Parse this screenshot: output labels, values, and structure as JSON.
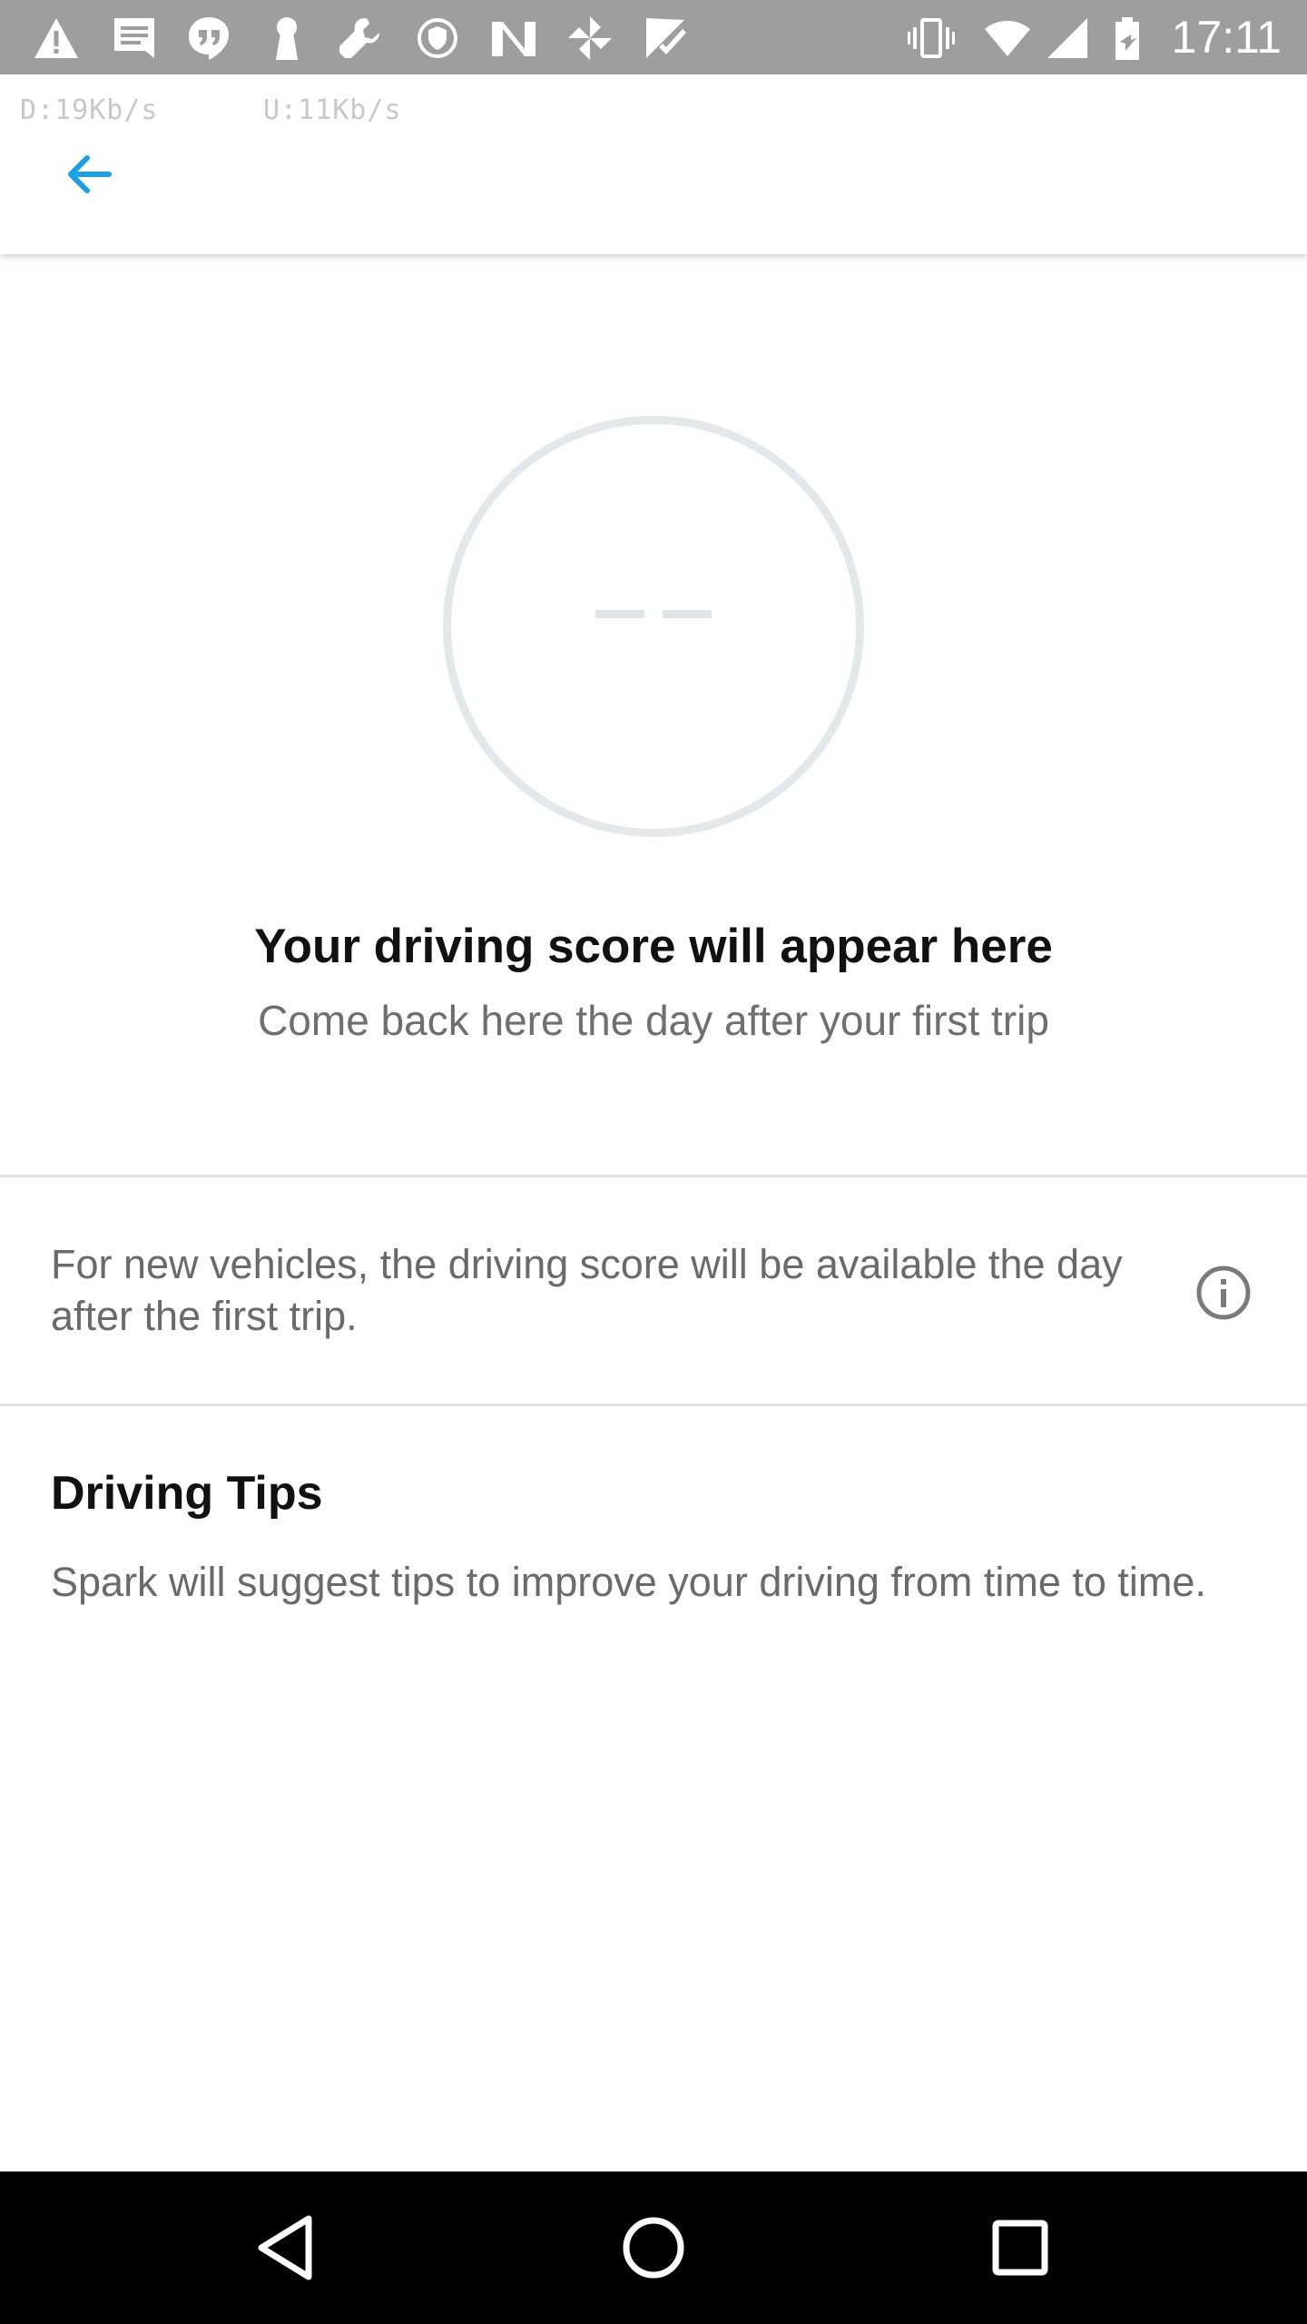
{
  "status_bar": {
    "time": "17:11",
    "background_color": "#9e9e9e",
    "left_icons": [
      "warning-icon",
      "message-icon",
      "hangouts-icon",
      "keyhole-icon",
      "wrench-icon",
      "vpn-shield-icon",
      "n-app-icon",
      "pinwheel-icon",
      "checkmark-flag-icon"
    ],
    "right_icons": [
      "vibrate-icon",
      "wifi-icon",
      "signal-icon",
      "battery-charging-icon"
    ]
  },
  "app_bar": {
    "download_speed": "D:19Kb/s",
    "upload_speed": "U:11Kb/s",
    "back_icon": "arrow-left-icon",
    "accent_color": "#1ba1e2"
  },
  "score": {
    "placeholder": "--",
    "headline": "Your driving score will appear here",
    "subline": "Come back here the day after your first trip"
  },
  "info": {
    "text": "For new vehicles, the driving score will be available the day after the first trip.",
    "icon": "info-icon"
  },
  "tips": {
    "title": "Driving Tips",
    "body": "Spark will suggest tips to improve your driving from time to time."
  },
  "nav_bar": {
    "buttons": [
      "back-triangle-icon",
      "home-circle-icon",
      "recents-square-icon"
    ]
  }
}
